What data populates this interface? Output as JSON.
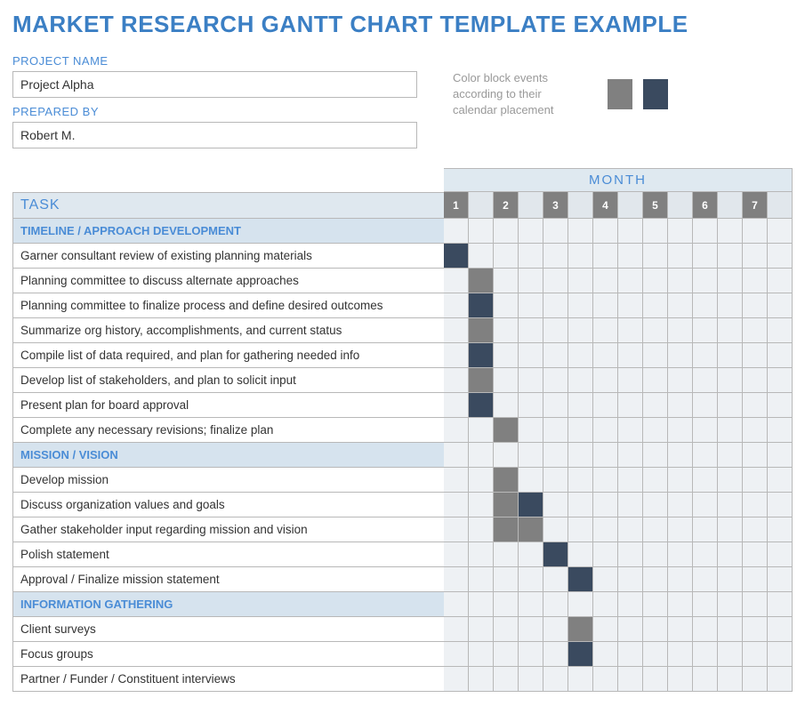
{
  "title": "MARKET RESEARCH GANTT CHART TEMPLATE EXAMPLE",
  "fields": {
    "project_name_label": "PROJECT NAME",
    "project_name_value": "Project Alpha",
    "prepared_by_label": "PREPARED BY",
    "prepared_by_value": "Robert M."
  },
  "legend": {
    "text": "Color block events according to their calendar placement",
    "colors": [
      "#808080",
      "#3a4a5f"
    ]
  },
  "headers": {
    "task": "TASK",
    "month": "MONTH"
  },
  "month_numbers": [
    "1",
    "",
    "2",
    "",
    "3",
    "",
    "4",
    "",
    "5",
    "",
    "6",
    "",
    "7",
    ""
  ],
  "chart_data": {
    "type": "gantt",
    "columns": 14,
    "legend": {
      "grey": "#808080",
      "dark": "#3a4a5f"
    },
    "sections": [
      {
        "name": "TIMELINE / APPROACH DEVELOPMENT",
        "tasks": [
          {
            "label": "Garner consultant review of existing planning materials",
            "bars": [
              {
                "col": 0,
                "color": "dark"
              }
            ]
          },
          {
            "label": "Planning committee to discuss alternate approaches",
            "bars": [
              {
                "col": 1,
                "color": "grey"
              }
            ]
          },
          {
            "label": "Planning committee to finalize process and define desired outcomes",
            "bars": [
              {
                "col": 1,
                "color": "dark"
              }
            ]
          },
          {
            "label": "Summarize org history, accomplishments, and current status",
            "bars": [
              {
                "col": 1,
                "color": "grey"
              }
            ]
          },
          {
            "label": "Compile list of data required, and plan for gathering needed info",
            "bars": [
              {
                "col": 1,
                "color": "dark"
              }
            ]
          },
          {
            "label": "Develop list of stakeholders, and plan to solicit input",
            "bars": [
              {
                "col": 1,
                "color": "grey"
              }
            ]
          },
          {
            "label": "Present plan for board approval",
            "bars": [
              {
                "col": 1,
                "color": "dark"
              }
            ]
          },
          {
            "label": "Complete any necessary revisions; finalize plan",
            "bars": [
              {
                "col": 2,
                "color": "grey"
              }
            ]
          }
        ]
      },
      {
        "name": "MISSION / VISION",
        "tasks": [
          {
            "label": "Develop mission",
            "bars": [
              {
                "col": 2,
                "color": "grey"
              }
            ]
          },
          {
            "label": "Discuss organization values and goals",
            "bars": [
              {
                "col": 2,
                "color": "grey"
              },
              {
                "col": 3,
                "color": "dark"
              }
            ]
          },
          {
            "label": "Gather stakeholder input regarding mission and vision",
            "bars": [
              {
                "col": 2,
                "color": "grey"
              },
              {
                "col": 3,
                "color": "grey"
              }
            ]
          },
          {
            "label": "Polish statement",
            "bars": [
              {
                "col": 4,
                "color": "dark"
              }
            ]
          },
          {
            "label": "Approval / Finalize mission statement",
            "bars": [
              {
                "col": 5,
                "color": "dark"
              }
            ]
          }
        ]
      },
      {
        "name": "INFORMATION GATHERING",
        "tasks": [
          {
            "label": "Client surveys",
            "bars": [
              {
                "col": 5,
                "color": "grey"
              }
            ]
          },
          {
            "label": "Focus groups",
            "bars": [
              {
                "col": 5,
                "color": "dark"
              }
            ]
          },
          {
            "label": "Partner / Funder / Constituent interviews",
            "bars": []
          }
        ]
      }
    ]
  }
}
